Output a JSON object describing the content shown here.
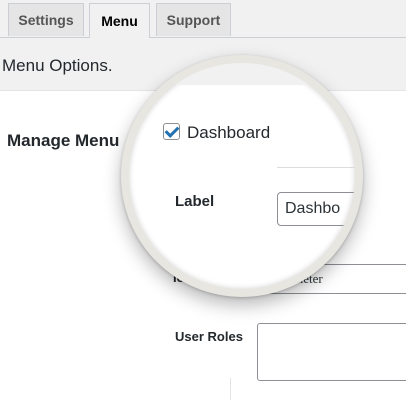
{
  "tabs": {
    "settings": "Settings",
    "menu": "Menu",
    "support": "Support"
  },
  "heading": "Menu Options.",
  "side_label": "Manage Menu",
  "form": {
    "icon_label": "Ic",
    "icon_value": "tachometer",
    "roles_label": "User Roles",
    "roles_value": ""
  },
  "magnifier": {
    "checkbox_label": "Dashboard",
    "checkbox_checked": true,
    "label_label": "Label",
    "label_value": "Dashbo"
  },
  "colors": {
    "accent": "#2271b1",
    "page_bg": "#f1f1f1",
    "panel_bg": "#ffffff"
  }
}
